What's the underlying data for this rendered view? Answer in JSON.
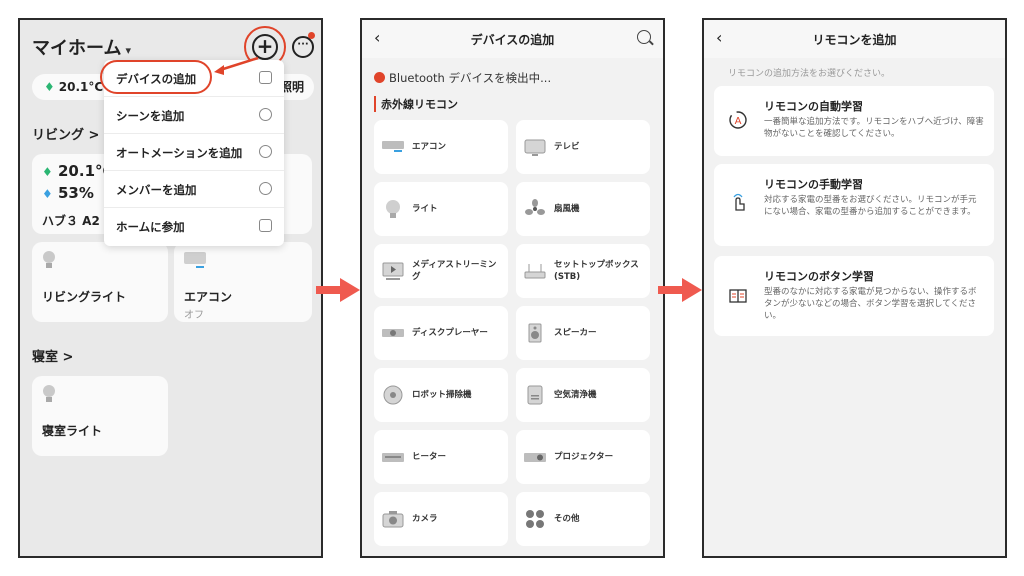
{
  "panel1": {
    "home_title": "マイホーム",
    "caret": "▾",
    "plus_symbol": "+",
    "more_symbol": "···",
    "weather_temp": "20.1°C",
    "weather_desc": "照明",
    "menu": [
      {
        "label": "デバイスの追加",
        "icon": "scan-icon"
      },
      {
        "label": "シーンを追加",
        "icon": "scene-icon"
      },
      {
        "label": "オートメーションを追加",
        "icon": "automation-icon"
      },
      {
        "label": "メンバーを追加",
        "icon": "person-icon"
      },
      {
        "label": "ホームに参加",
        "icon": "join-icon"
      }
    ],
    "living_title": "リビング >",
    "hub_temp": "20.1°C",
    "hub_humidity": "53%",
    "hub_name": "ハブ３ A2",
    "living_light": "リビングライト",
    "ac_name": "エアコン",
    "ac_status": "オフ",
    "bedroom_title": "寝室 >",
    "bedroom_light": "寝室ライト",
    "accent_color": "#e0442a"
  },
  "panel2": {
    "back": "‹",
    "title": "デバイスの追加",
    "bt_scan": "Bluetooth デバイスを検出中...",
    "ir_title": "赤外線リモコン",
    "devices": [
      {
        "label": "エアコン",
        "icon": "aircon-icon"
      },
      {
        "label": "テレビ",
        "icon": "tv-icon"
      },
      {
        "label": "ライト",
        "icon": "bulb-icon"
      },
      {
        "label": "扇風機",
        "icon": "fan-icon"
      },
      {
        "label": "メディアストリーミング",
        "icon": "media-icon"
      },
      {
        "label": "セットトップボックス (STB)",
        "icon": "stb-icon"
      },
      {
        "label": "ディスクプレーヤー",
        "icon": "disc-player-icon"
      },
      {
        "label": "スピーカー",
        "icon": "speaker-icon"
      },
      {
        "label": "ロボット掃除機",
        "icon": "robot-vacuum-icon"
      },
      {
        "label": "空気清浄機",
        "icon": "air-purifier-icon"
      },
      {
        "label": "ヒーター",
        "icon": "heater-icon"
      },
      {
        "label": "プロジェクター",
        "icon": "projector-icon"
      },
      {
        "label": "カメラ",
        "icon": "camera-icon"
      },
      {
        "label": "その他",
        "icon": "other-icon"
      }
    ]
  },
  "panel3": {
    "back": "‹",
    "title": "リモコンを追加",
    "hint": "リモコンの追加方法をお選びください。",
    "options": [
      {
        "title": "リモコンの自動学習",
        "desc": "一番簡単な追加方法です。リモコンをハブへ近づけ、障害物がないことを確認してください。",
        "icon": "auto-learn-icon"
      },
      {
        "title": "リモコンの手動学習",
        "desc": "対応する家電の型番をお選びください。リモコンが手元にない場合、家電の型番から追加することができます。",
        "icon": "hand-tap-icon"
      },
      {
        "title": "リモコンのボタン学習",
        "desc": "型番のなかに対応する家電が見つからない、操作するボタンが少ないなどの場合、ボタン学習を選択してください。",
        "icon": "book-icon"
      }
    ]
  },
  "arrow_color": "#ef5a4f"
}
